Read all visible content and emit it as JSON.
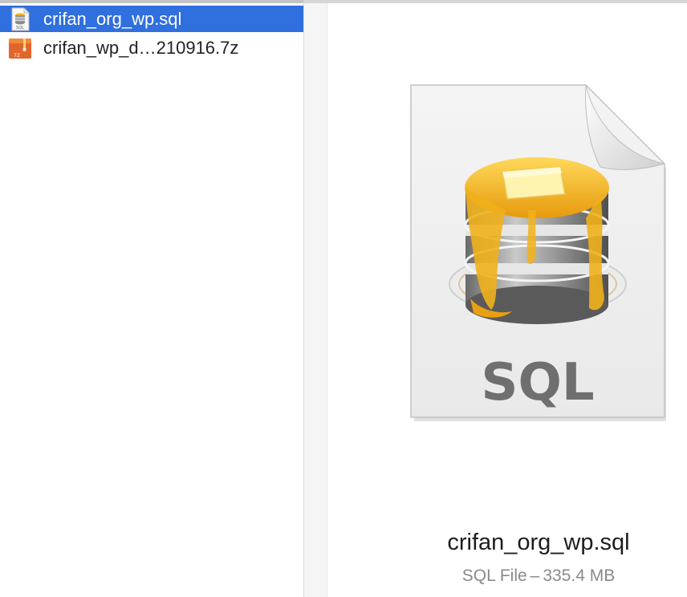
{
  "files": [
    {
      "name": "crifan_org_wp.sql",
      "icon": "sql-file-icon",
      "selected": true
    },
    {
      "name": "crifan_wp_d…210916.7z",
      "icon": "7z-archive-icon",
      "selected": false
    }
  ],
  "preview": {
    "icon": "sql-document-icon",
    "icon_label": "SQL",
    "file_name": "crifan_org_wp.sql",
    "kind": "SQL File",
    "separator": "–",
    "size": "335.4 MB"
  },
  "colors": {
    "selection": "#2f6fde",
    "honey": "#f2b21a",
    "archive": "#e2652b"
  }
}
